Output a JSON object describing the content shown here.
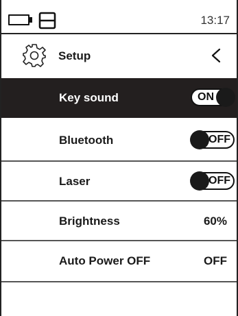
{
  "status_bar": {
    "battery_icon": "battery-icon",
    "save_icon": "save-icon",
    "time": "13:17"
  },
  "header": {
    "icon": "gear-icon",
    "title": "Setup",
    "back_icon": "chevron-left-icon"
  },
  "settings": [
    {
      "label": "Key sound",
      "type": "toggle",
      "state": "on",
      "value": "ON",
      "selected": true
    },
    {
      "label": "Bluetooth",
      "type": "toggle",
      "state": "off",
      "value": "OFF",
      "selected": false
    },
    {
      "label": "Laser",
      "type": "toggle",
      "state": "off",
      "value": "OFF",
      "selected": false
    },
    {
      "label": "Brightness",
      "type": "value",
      "value": "60%",
      "selected": false
    },
    {
      "label": "Auto Power OFF",
      "type": "value",
      "value": "OFF",
      "selected": false
    }
  ],
  "colors": {
    "selected_row_background": "#231f1f",
    "selected_row_text": "#ffffff",
    "text": "#1a1a1a",
    "background": "#ffffff"
  }
}
